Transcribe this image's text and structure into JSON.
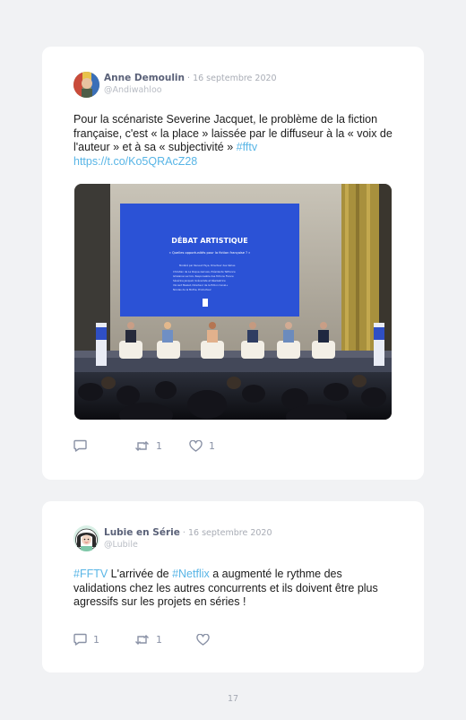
{
  "tweets": [
    {
      "author": "Anne Demoulin",
      "separator": " · ",
      "date": "16 septembre 2020",
      "handle": "@Andiwahloo",
      "text_1": "Pour la scénariste Severine Jacquet, le problème de la fiction française, c'est «  la place » laissée par le diffuseur à la « voix de l'auteur » et à sa « subjectivité » ",
      "hashtag_1": "#fftv",
      "link": "https://t.co/Ko5QRAcZ28",
      "photo": {
        "screen_title": "DÉBAT ARTISTIQUE",
        "screen_subtitle": "« Quelles opportunités pour la fiction française ? »",
        "screen_lines": [
          "Modéré par Renaud Faye, Directeur des Séries",
          "Christian de La Roque-Gervais, Présidente Telfrance",
          "Ghislaine Lacroix, Responsable des fictions France",
          "Sévérine Jacquet, Scénariste et Réalisatrice",
          "Vincent Meslet, Directeur de la fiction Canal+",
          "Nicolas de la Mothe, Producteur"
        ]
      },
      "stats": {
        "replies": "",
        "retweets": "1",
        "likes": "1"
      }
    },
    {
      "author": "Lubie en Série",
      "separator": " · ",
      "date": "16 septembre 2020",
      "handle": "@Lubile",
      "hashtag_1": "#FFTV",
      "text_1": " L'arrivée de ",
      "hashtag_2": "#Netflix",
      "text_2": "  a augmenté le rythme des validations chez les autres concurrents et ils doivent être plus agressifs sur les projets en séries !",
      "stats": {
        "replies": "1",
        "retweets": "1",
        "likes": ""
      }
    }
  ],
  "icons": {
    "reply": "reply-icon",
    "retweet": "retweet-icon",
    "like": "heart-icon"
  },
  "colors": {
    "link": "#58b5e6",
    "name": "#5a6178",
    "meta": "#a8acb5",
    "background": "#f1f2f4"
  },
  "page_number": "17"
}
